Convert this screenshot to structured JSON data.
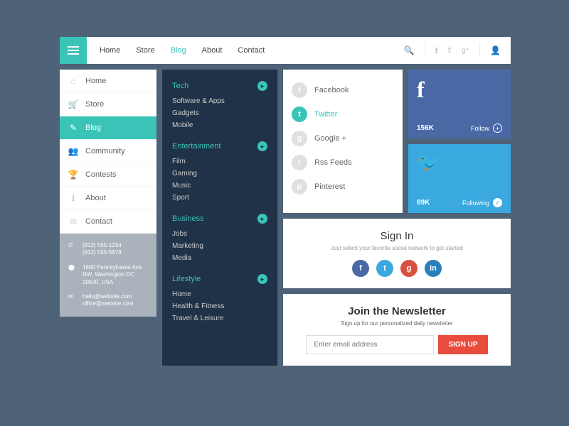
{
  "topnav": {
    "items": [
      "Home",
      "Store",
      "Blog",
      "About",
      "Contact"
    ],
    "active_index": 2
  },
  "sidebar": {
    "items": [
      {
        "icon": "home",
        "label": "Home"
      },
      {
        "icon": "cart",
        "label": "Store"
      },
      {
        "icon": "edit",
        "label": "Blog"
      },
      {
        "icon": "people",
        "label": "Community"
      },
      {
        "icon": "trophy",
        "label": "Contests"
      },
      {
        "icon": "info",
        "label": "About"
      },
      {
        "icon": "mail",
        "label": "Contact"
      }
    ],
    "active_index": 2,
    "contact": {
      "phone1": "(912) 555-1234",
      "phone2": "(912) 555-5678",
      "address": "1600 Pennsylvania Ave NW, Washington DC 20500, USA",
      "email1": "hello@website.com",
      "email2": "office@website.com"
    }
  },
  "categories": [
    {
      "header": "Tech",
      "items": [
        "Software & Apps",
        "Gadgets",
        "Mobile"
      ]
    },
    {
      "header": "Entertainment",
      "items": [
        "Film",
        "Gaming",
        "Music",
        "Sport"
      ]
    },
    {
      "header": "Business",
      "items": [
        "Jobs",
        "Marketing",
        "Media"
      ]
    },
    {
      "header": "Lifestyle",
      "items": [
        "Home",
        "Health & Fitness",
        "Travel & Leisure"
      ]
    }
  ],
  "social_list": {
    "items": [
      {
        "label": "Facebook",
        "glyph": "f"
      },
      {
        "label": "Twitter",
        "glyph": "t"
      },
      {
        "label": "Google +",
        "glyph": "g"
      },
      {
        "label": "Rss Feeds",
        "glyph": "r"
      },
      {
        "label": "Pinterest",
        "glyph": "p"
      }
    ],
    "active_index": 1
  },
  "facebook_card": {
    "count": "156K",
    "action": "Follow"
  },
  "twitter_card": {
    "count": "89K",
    "action": "Following"
  },
  "signin": {
    "title": "Sign In",
    "subtitle": "Just select your favorite social network to get started"
  },
  "newsletter": {
    "title": "Join the Newsletter",
    "subtitle": "Sign up for our personalized daily newsletter",
    "placeholder": "Enter email address",
    "button": "SIGN UP"
  }
}
